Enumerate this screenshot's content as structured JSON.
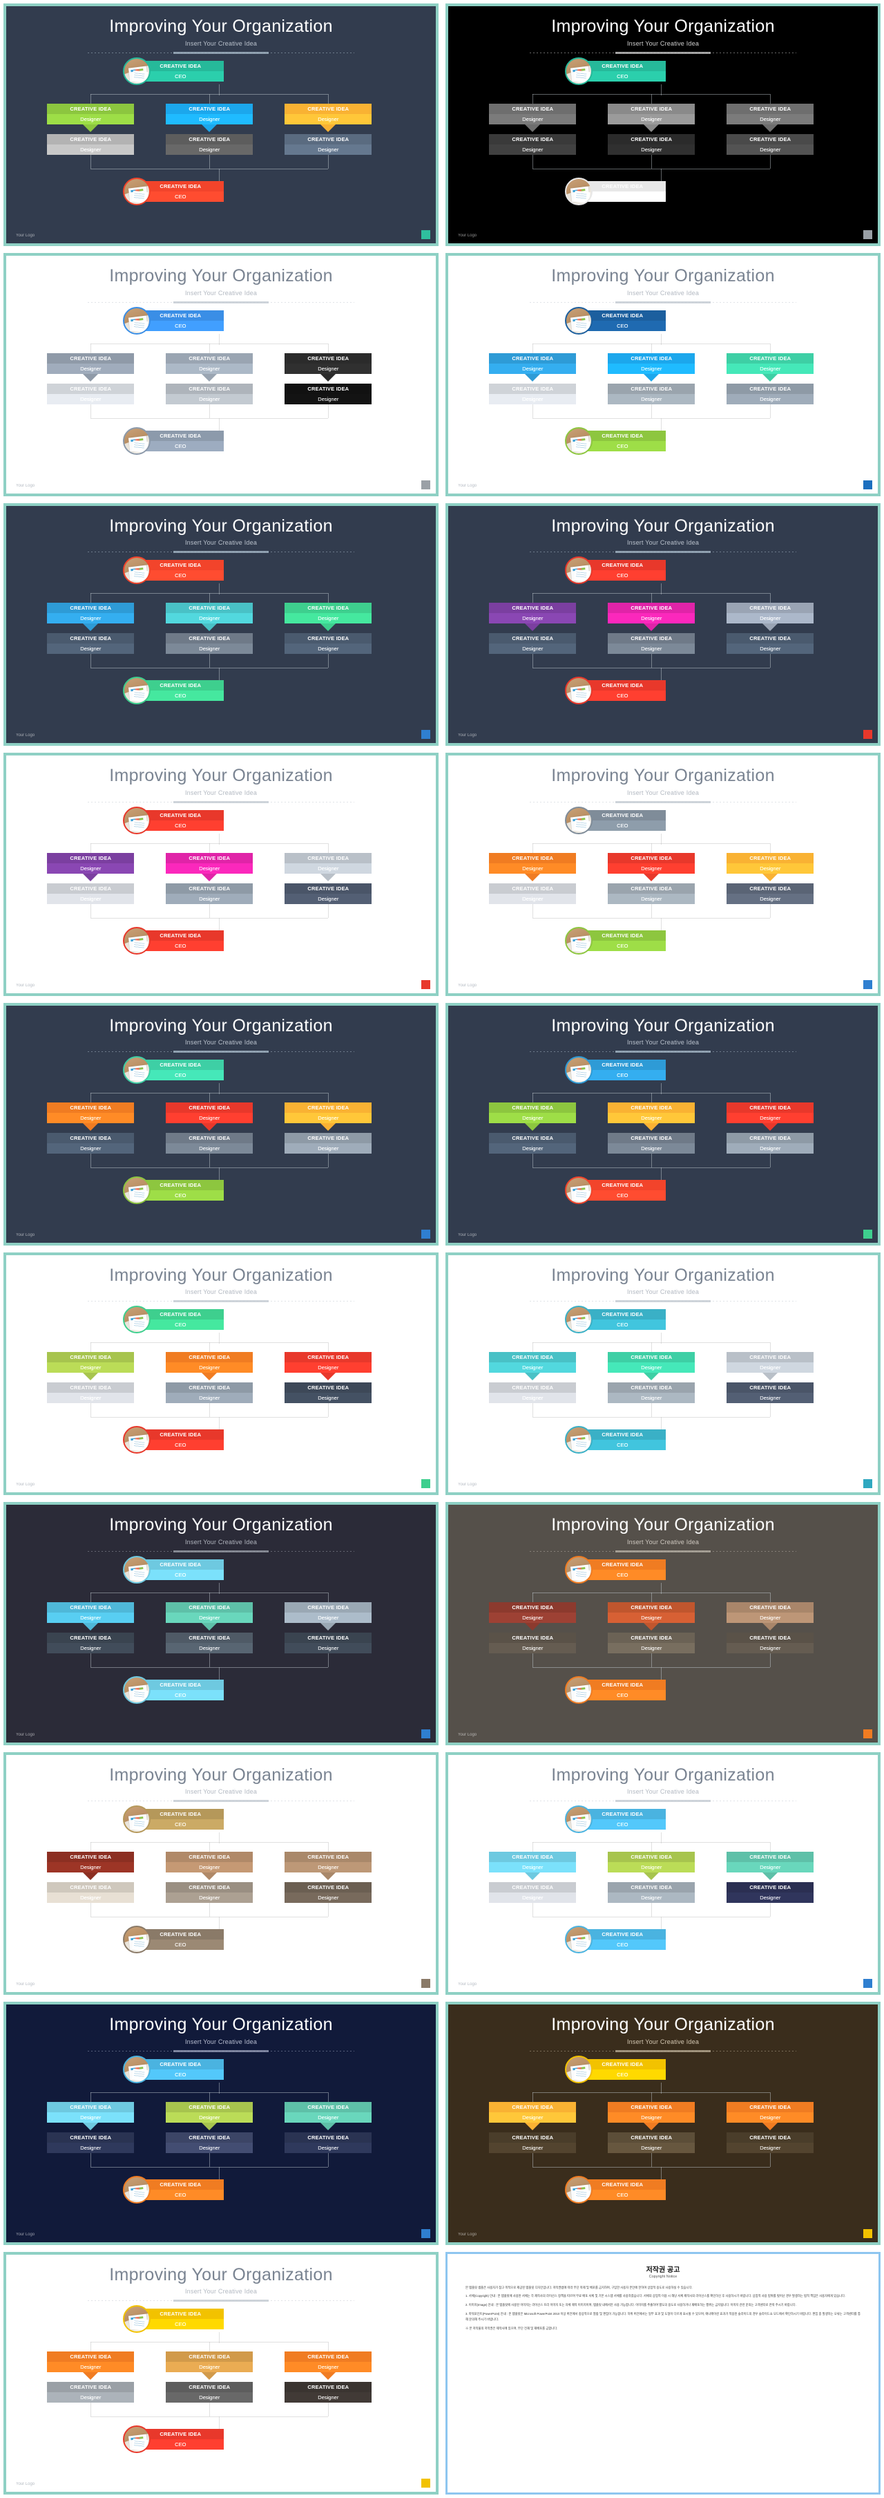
{
  "deck": {
    "title": "Improving Your Organization",
    "subtitle": "Insert Your Creative Idea",
    "logo": "Your Logo",
    "node_title": "CREATIVE IDEA",
    "role_ceo": "CEO",
    "role_designer": "Designer"
  },
  "slides": [
    {
      "n": "1",
      "bg": "#323c4e",
      "title_color": "#ffffff",
      "sub_color": "#b9c1cc",
      "rule_color": "#9fb0bf",
      "top": "#26b99a",
      "bottom": "#f2442b",
      "badge": "#2fbf9e",
      "row1": [
        "#8cc63f",
        "#1ca7ec",
        "#f9b233"
      ],
      "row2": [
        "#b3b3b3",
        "#5d5d5d",
        "#5a6b80"
      ]
    },
    {
      "n": "2",
      "bg": "#000000",
      "title_color": "#ffffff",
      "sub_color": "#cfcfcf",
      "rule_color": "#bdbdbd",
      "top": "#26b99a",
      "bottom": "#e8e8e8",
      "badge": "#9aa0a6",
      "row1": [
        "#6e6e6e",
        "#8a8a8a",
        "#6e6e6e"
      ],
      "row2": [
        "#3a3a3a",
        "#2b2b2b",
        "#4a4a4a"
      ]
    },
    {
      "n": "3",
      "bg": "#ffffff",
      "title_color": "#7a8492",
      "sub_color": "#b3b9c2",
      "rule_color": "#c6ccd4",
      "top": "#3a8ee6",
      "bottom": "#8c9aab",
      "badge": "#9aa0a6",
      "row1": [
        "#8f9aa8",
        "#9aa5b2",
        "#2b2b2b"
      ],
      "row2": [
        "#cfd3d8",
        "#aeb4bb",
        "#111111"
      ]
    },
    {
      "n": "4",
      "bg": "#ffffff",
      "title_color": "#7a8492",
      "sub_color": "#b3b9c2",
      "rule_color": "#c6ccd4",
      "top": "#1c5f9e",
      "bottom": "#8dc63f",
      "badge": "#1c6fbf",
      "row1": [
        "#2e9bd6",
        "#1ca7ec",
        "#3ecfa5"
      ],
      "row2": [
        "#cfd3d8",
        "#9aa4ad",
        "#8e9aa6"
      ]
    },
    {
      "n": "5",
      "bg": "#323c4e",
      "title_color": "#ffffff",
      "sub_color": "#b9c1cc",
      "rule_color": "#9fb0bf",
      "top": "#f2442b",
      "bottom": "#3ecf8e",
      "badge": "#2f7fd0",
      "row1": [
        "#2e9bd6",
        "#49c1c6",
        "#3ecf8e"
      ],
      "row2": [
        "#4a5a6e",
        "#6f7a88",
        "#4a5a6e"
      ]
    },
    {
      "n": "6",
      "bg": "#323c4e",
      "title_color": "#ffffff",
      "sub_color": "#b9c1cc",
      "rule_color": "#9fb0bf",
      "top": "#e8382b",
      "bottom": "#e8382b",
      "badge": "#e8382b",
      "row1": [
        "#7b3fa0",
        "#e024a8",
        "#9aa4b4"
      ],
      "row2": [
        "#4a5a6e",
        "#6f7a88",
        "#4a5a6e"
      ]
    },
    {
      "n": "7",
      "bg": "#ffffff",
      "title_color": "#7a8492",
      "sub_color": "#b3b9c2",
      "rule_color": "#c6ccd4",
      "top": "#e8382b",
      "bottom": "#e8382b",
      "badge": "#e8382b",
      "row1": [
        "#7b3fa0",
        "#e024a8",
        "#b9c0c8"
      ],
      "row2": [
        "#c9ccd1",
        "#8e9aa6",
        "#4a5568"
      ]
    },
    {
      "n": "8",
      "bg": "#ffffff",
      "title_color": "#7a8492",
      "sub_color": "#b3b9c2",
      "rule_color": "#c6ccd4",
      "top": "#7f8c99",
      "bottom": "#8dc63f",
      "badge": "#2f7fd0",
      "row1": [
        "#f07c22",
        "#e8382b",
        "#f9b233"
      ],
      "row2": [
        "#c9ccd1",
        "#9aa4ad",
        "#5a6475"
      ]
    },
    {
      "n": "9",
      "bg": "#323c4e",
      "title_color": "#ffffff",
      "sub_color": "#b9c1cc",
      "rule_color": "#9fb0bf",
      "top": "#3ecfa5",
      "bottom": "#8dc63f",
      "badge": "#2f7fd0",
      "row1": [
        "#f07c22",
        "#e8382b",
        "#f9b233"
      ],
      "row2": [
        "#4a5a6e",
        "#6f7a88",
        "#8e9aa6"
      ]
    },
    {
      "n": "10",
      "bg": "#323c4e",
      "title_color": "#ffffff",
      "sub_color": "#b9c1cc",
      "rule_color": "#9fb0bf",
      "top": "#2e9bd6",
      "bottom": "#f2442b",
      "badge": "#3ecf8e",
      "row1": [
        "#8dc63f",
        "#f9b233",
        "#e8382b"
      ],
      "row2": [
        "#4a5a6e",
        "#6f7a88",
        "#8e9aa6"
      ]
    },
    {
      "n": "11",
      "bg": "#ffffff",
      "title_color": "#7a8492",
      "sub_color": "#b3b9c2",
      "rule_color": "#c6ccd4",
      "top": "#3ecf8e",
      "bottom": "#e8382b",
      "badge": "#3ecf8e",
      "row1": [
        "#a7c44e",
        "#f07c22",
        "#e8382b"
      ],
      "row2": [
        "#c9ccd1",
        "#8e9aa6",
        "#3d4858"
      ]
    },
    {
      "n": "12",
      "bg": "#ffffff",
      "title_color": "#7a8492",
      "sub_color": "#b3b9c2",
      "rule_color": "#c6ccd4",
      "top": "#3ab0c6",
      "bottom": "#3ab0c6",
      "badge": "#2fa8c0",
      "row1": [
        "#49c1c6",
        "#3ecfa5",
        "#b9c0c8"
      ],
      "row2": [
        "#c9ccd1",
        "#9aa4ad",
        "#4a5568"
      ]
    },
    {
      "n": "13",
      "bg": "#2b2b38",
      "title_color": "#ffffff",
      "sub_color": "#b0b4bd",
      "rule_color": "#9296a0",
      "top": "#6ec9e0",
      "bottom": "#6ec9e0",
      "badge": "#2f7fd0",
      "row1": [
        "#4fb8d8",
        "#5ec0a8",
        "#9aa8b4"
      ],
      "row2": [
        "#3a4450",
        "#4f5a66",
        "#3a4450"
      ]
    },
    {
      "n": "14",
      "bg": "#55504a",
      "title_color": "#ffffff",
      "sub_color": "#cfc9c0",
      "rule_color": "#b0a99f",
      "top": "#f07c22",
      "bottom": "#f07c22",
      "badge": "#f07c22",
      "row1": [
        "#8c3a2e",
        "#c0562e",
        "#a9866a"
      ],
      "row2": [
        "#5a5248",
        "#6b6255",
        "#5a5248"
      ]
    },
    {
      "n": "15",
      "bg": "#ffffff",
      "title_color": "#7a8492",
      "sub_color": "#b3b9c2",
      "rule_color": "#c6ccd4",
      "top": "#b5985a",
      "bottom": "#8a7a68",
      "badge": "#8a7a68",
      "row1": [
        "#8c2f22",
        "#b08968",
        "#a9886a"
      ],
      "row2": [
        "#cfc8bd",
        "#9a8f82",
        "#6b5f52"
      ]
    },
    {
      "n": "16",
      "bg": "#ffffff",
      "title_color": "#7a8492",
      "sub_color": "#b3b9c2",
      "rule_color": "#c6ccd4",
      "top": "#4ab3e0",
      "bottom": "#4ab3e0",
      "badge": "#2f7fd0",
      "row1": [
        "#6ec9e0",
        "#a7c44e",
        "#5ec0a8"
      ],
      "row2": [
        "#c9ccd1",
        "#9aa4ad",
        "#2b2f52"
      ]
    },
    {
      "n": "17",
      "bg": "#111a3a",
      "title_color": "#ffffff",
      "sub_color": "#b7bdd0",
      "rule_color": "#8f97b0",
      "top": "#4ab3e0",
      "bottom": "#f07c22",
      "badge": "#2f7fd0",
      "row1": [
        "#6ec9e0",
        "#a7c44e",
        "#5ec0a8"
      ],
      "row2": [
        "#2a3352",
        "#3c4566",
        "#2a3352"
      ]
    },
    {
      "n": "18",
      "bg": "#3a2d1c",
      "title_color": "#ffffff",
      "sub_color": "#d3c7b2",
      "rule_color": "#b0a38c",
      "top": "#f2c200",
      "bottom": "#f07c22",
      "badge": "#f2c200",
      "row1": [
        "#f9b233",
        "#f07c22",
        "#f07c22"
      ],
      "row2": [
        "#4a3d2a",
        "#5c4e38",
        "#4a3d2a"
      ]
    },
    {
      "n": "19",
      "bg": "#ffffff",
      "title_color": "#7a8492",
      "sub_color": "#b3b9c2",
      "rule_color": "#c6ccd4",
      "top": "#f2c200",
      "bottom": "#e8382b",
      "badge": "#f2c200",
      "row1": [
        "#f07c22",
        "#d19a4a",
        "#f07c22"
      ],
      "row2": [
        "#9aa0a6",
        "#5d5d5d",
        "#3a3430"
      ]
    }
  ],
  "doc": {
    "title": "저작권 공고",
    "subtitle": "Copyright Notice",
    "paragraphs": [
      "본 템플릿 샘플은 사용자가 참고 목적으로 제공된 템플릿 디자인입니다. 저작권법에 따라 무단 복제 및 배포를 금지하며, 구입한 사용자 본인에 한하여 상업적 용도로 사용하실 수 있습니다.",
      "1. 서체(Copyright) 안내 : 본 템플릿에 사용된 서체는 각 제작사의 라이선스 정책을 따르며 무료 배포 서체 및 기본 시스템 서체를 사용하였습니다. 서체의 상업적 이용 시 해당 서체 제작사의 라이선스를 확인하신 후 사용하시기 바랍니다. 상업적 사용 범위를 벗어난 경우 발생하는 법적 책임은 사용자에게 있습니다.",
      "2. 이미지(Image) 안내 : 본 템플릿에 사용된 이미지는 라이선스 프리 이미지 또는 자체 제작 이미지이며, 템플릿 내에서만 사용 가능합니다. 이미지를 추출하여 별도의 용도로 사용하거나 재배포하는 행위는 금지됩니다. 이미지 관련 문의는 고객센터로 연락 주시기 바랍니다.",
      "3. 파워포인트(PowerPoint) 안내 : 본 템플릿은 Microsoft PowerPoint 2010 이상 버전에서 정상적으로 열람 및 편집이 가능합니다. 하위 버전에서는 일부 효과 및 도형이 다르게 표시될 수 있으며, 애니메이션 효과가 적용된 슬라이드의 경우 슬라이드쇼 모드에서 확인하시기 바랍니다. 편집 중 발생하는 오류는 고객센터를 통해 문의해 주시기 바랍니다.",
      "※ 본 저작물의 저작권은 제작사에 있으며, 무단 전재 및 재배포를 금합니다."
    ]
  }
}
